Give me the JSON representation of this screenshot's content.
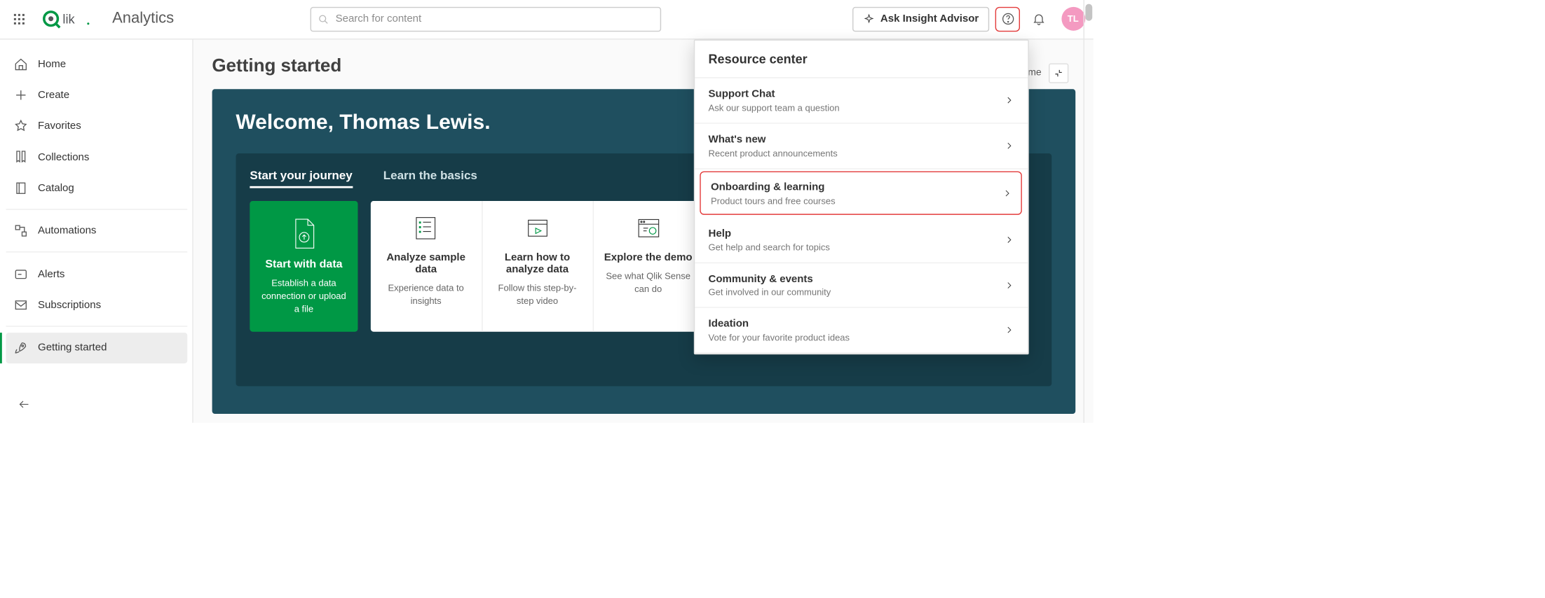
{
  "header": {
    "product": "Analytics",
    "search_placeholder": "Search for content",
    "ask_label": "Ask Insight Advisor",
    "avatar_initials": "TL"
  },
  "sidebar": {
    "groups": [
      {
        "items": [
          {
            "label": "Home",
            "icon": "home"
          },
          {
            "label": "Create",
            "icon": "plus"
          },
          {
            "label": "Favorites",
            "icon": "star"
          },
          {
            "label": "Collections",
            "icon": "bookmark"
          },
          {
            "label": "Catalog",
            "icon": "book"
          }
        ]
      },
      {
        "items": [
          {
            "label": "Automations",
            "icon": "automation"
          }
        ]
      },
      {
        "items": [
          {
            "label": "Alerts",
            "icon": "alert"
          },
          {
            "label": "Subscriptions",
            "icon": "mail"
          }
        ]
      },
      {
        "items": [
          {
            "label": "Getting started",
            "icon": "rocket",
            "active": true
          }
        ]
      }
    ]
  },
  "main": {
    "title": "Getting started",
    "hide_label": "lcome",
    "hero_title": "Welcome, Thomas Lewis.",
    "tabs": [
      {
        "label": "Start your journey",
        "active": true
      },
      {
        "label": "Learn the basics",
        "active": false
      }
    ],
    "start_card": {
      "title": "Start with data",
      "subtitle": "Establish a data connection or upload a file"
    },
    "cards": [
      {
        "title": "Analyze sample data",
        "subtitle": "Experience data to insights"
      },
      {
        "title": "Learn how to analyze data",
        "subtitle": "Follow this step-by-step video"
      },
      {
        "title": "Explore the demo",
        "subtitle": "See what Qlik Sense can do"
      }
    ]
  },
  "popover": {
    "title": "Resource center",
    "items": [
      {
        "title": "Support Chat",
        "subtitle": "Ask our support team a question"
      },
      {
        "title": "What's new",
        "subtitle": "Recent product announcements"
      },
      {
        "title": "Onboarding & learning",
        "subtitle": "Product tours and free courses",
        "highlighted": true
      },
      {
        "title": "Help",
        "subtitle": "Get help and search for topics"
      },
      {
        "title": "Community & events",
        "subtitle": "Get involved in our community"
      },
      {
        "title": "Ideation",
        "subtitle": "Vote for your favorite product ideas"
      }
    ]
  }
}
